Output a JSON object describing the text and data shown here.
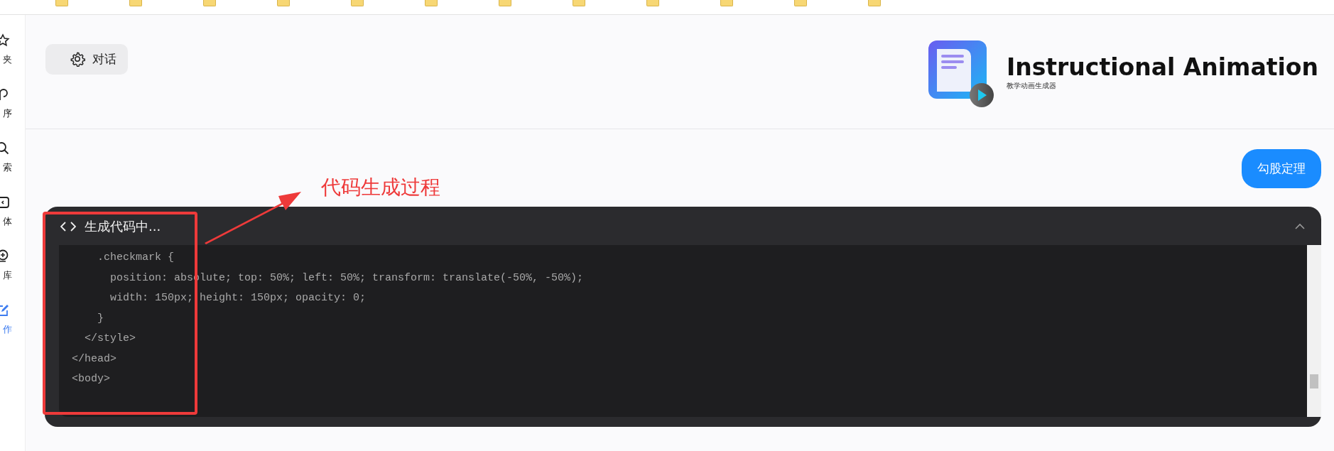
{
  "sidebar": {
    "items": [
      {
        "label": "夹",
        "kind": "star",
        "selected": false
      },
      {
        "label": "序",
        "kind": "hook",
        "selected": false
      },
      {
        "label": "索",
        "kind": "search",
        "selected": false
      },
      {
        "label": "体",
        "kind": "agent",
        "selected": false
      },
      {
        "label": "库",
        "kind": "bulb",
        "selected": false
      },
      {
        "label": "作",
        "kind": "pen",
        "selected": true
      }
    ]
  },
  "header": {
    "chat_button": "对话",
    "app_title": "Instructional Animation",
    "app_subtitle": "教学动画生成器"
  },
  "user_message": "勾股定理",
  "code_panel": {
    "title": "生成代码中...",
    "lines": [
      "      .checkmark {",
      "        position: absolute; top: 50%; left: 50%; transform: translate(-50%, -50%);",
      "        width: 150px; height: 150px; opacity: 0;",
      "      }",
      "    </style>",
      "  </head>",
      "  <body>"
    ]
  },
  "annotation": {
    "text": "代码生成过程"
  }
}
